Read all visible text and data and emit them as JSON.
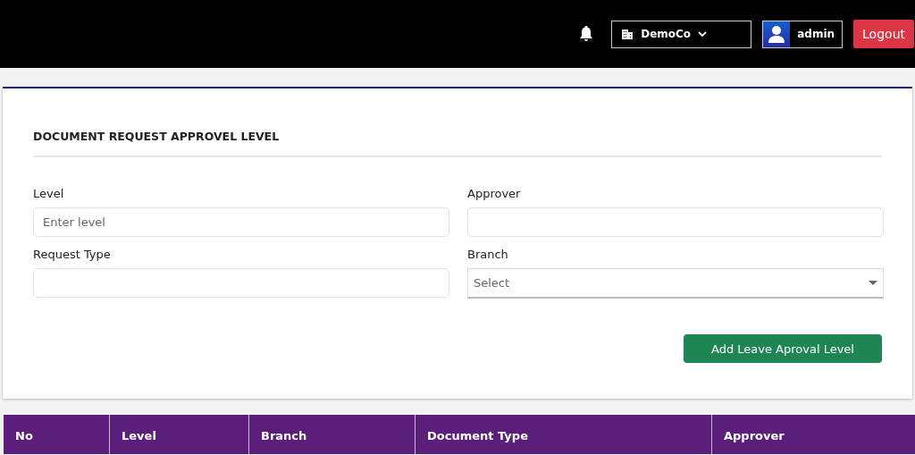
{
  "header": {
    "company": "DemoCo",
    "user": "admin",
    "logout": "Logout"
  },
  "form": {
    "title": "DOCUMENT REQUEST APPROVEL LEVEL",
    "fields": [
      {
        "label": "Level",
        "kind": "text",
        "placeholder": "Enter level"
      },
      {
        "label": "Approver",
        "kind": "text"
      },
      {
        "label": "Request Type",
        "kind": "text"
      },
      {
        "label": "Branch",
        "kind": "select",
        "placeholder": "Select"
      }
    ],
    "submit": "Add Leave Aproval Level"
  },
  "table": {
    "columns": [
      "No",
      "Level",
      "Branch",
      "Document Type",
      "Approver"
    ]
  }
}
